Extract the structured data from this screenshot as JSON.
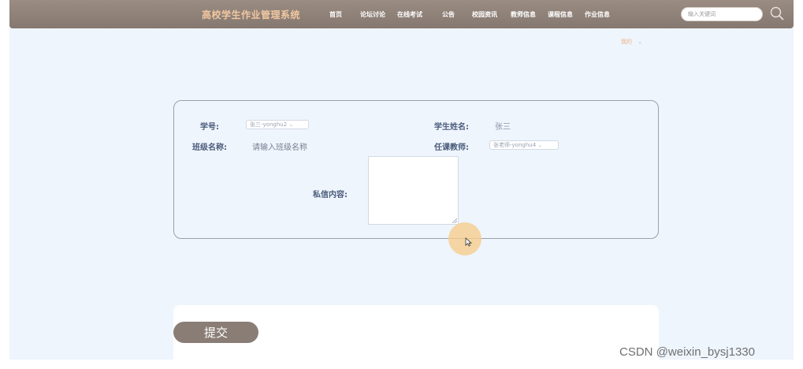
{
  "navbar": {
    "brand": "高校学生作业管理系统",
    "items": [
      "首页",
      "论坛讨论",
      "在线考试",
      "公告",
      "校园资讯",
      "教师信息",
      "课程信息",
      "作业信息"
    ],
    "search_placeholder": "输入关键词",
    "bg_color": "#8a7d76",
    "brand_color": "#f1c7a0"
  },
  "user_menu": {
    "label": "我的",
    "icon": "chevron-down-icon"
  },
  "form": {
    "student_no_label": "学号:",
    "student_no_value": "张三-yonghu2",
    "student_name_label": "学生姓名:",
    "student_name_value": "张三",
    "class_name_label": "班级名称:",
    "class_name_placeholder": "请输入班级名称",
    "teacher_label": "任课教师:",
    "teacher_value": "张老师-yonghu4",
    "message_label": "私信内容:"
  },
  "submit_label": "提交",
  "watermark": "CSDN @weixin_bysj1330"
}
